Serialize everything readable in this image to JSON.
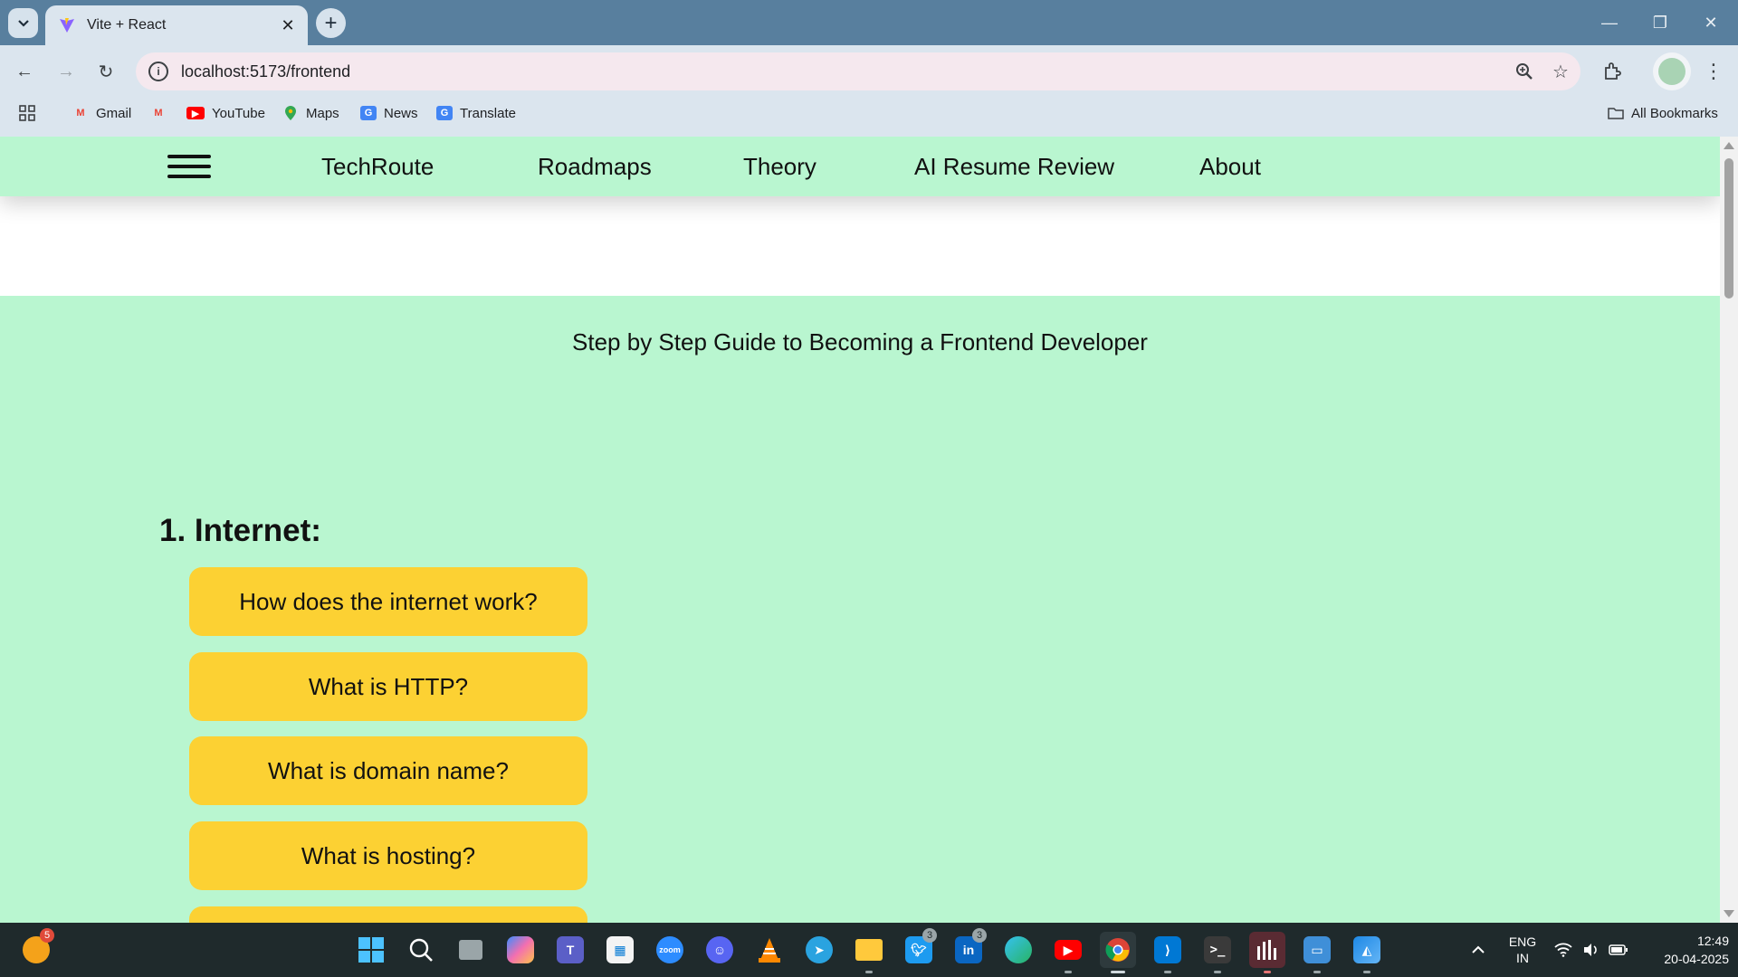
{
  "browser": {
    "tab_title": "Vite + React",
    "url": "localhost:5173/frontend",
    "bookmarks": [
      "Gmail",
      "YouTube",
      "Maps",
      "News",
      "Translate"
    ],
    "all_bookmarks": "All Bookmarks"
  },
  "site": {
    "brand": "TechRoute",
    "nav": [
      "Roadmaps",
      "Theory",
      "AI Resume Review",
      "About"
    ],
    "guide_title": "Step by Step Guide to Becoming a Frontend Developer",
    "section_title": "1. Internet:",
    "questions": [
      "How does the internet work?",
      "What is HTTP?",
      "What is domain name?",
      "What is hosting?"
    ],
    "accent_color": "#b9f6d0",
    "button_color": "#fcd133"
  },
  "taskbar": {
    "widget_badge": "5",
    "twitter_badge": "3",
    "linkedin_badge": "3",
    "lang": "ENG",
    "region": "IN",
    "time": "12:49",
    "date": "20-04-2025"
  }
}
